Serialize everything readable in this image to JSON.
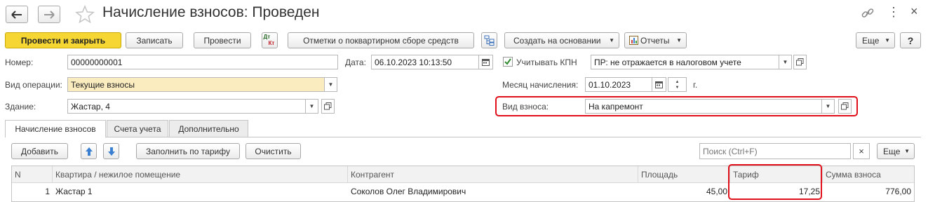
{
  "window": {
    "title": "Начисление взносов: Проведен",
    "more_icon": "⋮",
    "close_icon": "×"
  },
  "toolbar": {
    "post_close": "Провести и закрыть",
    "save": "Записать",
    "post": "Провести",
    "dt_kt_top": "Дт",
    "dt_kt_bottom": "Кт",
    "quarterly_marks": "Отметки о поквартирном сборе средств",
    "create_based": "Создать на основании",
    "reports": "Отчеты",
    "more": "Еще",
    "help": "?"
  },
  "form": {
    "number_label": "Номер:",
    "number_value": "00000000001",
    "date_label": "Дата:",
    "date_value": "06.10.2023 10:13:50",
    "kpn_label": "Учитывать КПН",
    "kpn_checked": true,
    "kpn_value": "ПР: не отражается в налоговом учете",
    "operation_label": "Вид операции:",
    "operation_value": "Текущие взносы",
    "month_label": "Месяц начисления:",
    "month_value": "01.10.2023",
    "month_suffix": "г.",
    "building_label": "Здание:",
    "building_value": "Жастар, 4",
    "fee_type_label": "Вид взноса:",
    "fee_type_value": "На капремонт"
  },
  "tabs": [
    {
      "label": "Начисление взносов",
      "active": true
    },
    {
      "label": "Счета учета",
      "active": false
    },
    {
      "label": "Дополнительно",
      "active": false
    }
  ],
  "table_toolbar": {
    "add": "Добавить",
    "fill_by_tariff": "Заполнить по тарифу",
    "clear": "Очистить",
    "search_placeholder": "Поиск (Ctrl+F)",
    "clear_search": "×",
    "more": "Еще"
  },
  "table": {
    "columns": [
      "N",
      "Квартира / нежилое помещение",
      "Контрагент",
      "Площадь",
      "Тариф",
      "Сумма взноса"
    ],
    "rows": [
      {
        "n": "1",
        "apartment": "Жастар 1",
        "counterparty": "Соколов Олег Владимирович",
        "area": "45,00",
        "tariff": "17,25",
        "amount": "776,00"
      }
    ]
  },
  "colors": {
    "accent_yellow": "#f5d632",
    "highlight_red": "#e0101a",
    "required_field": "#fbecc0"
  }
}
